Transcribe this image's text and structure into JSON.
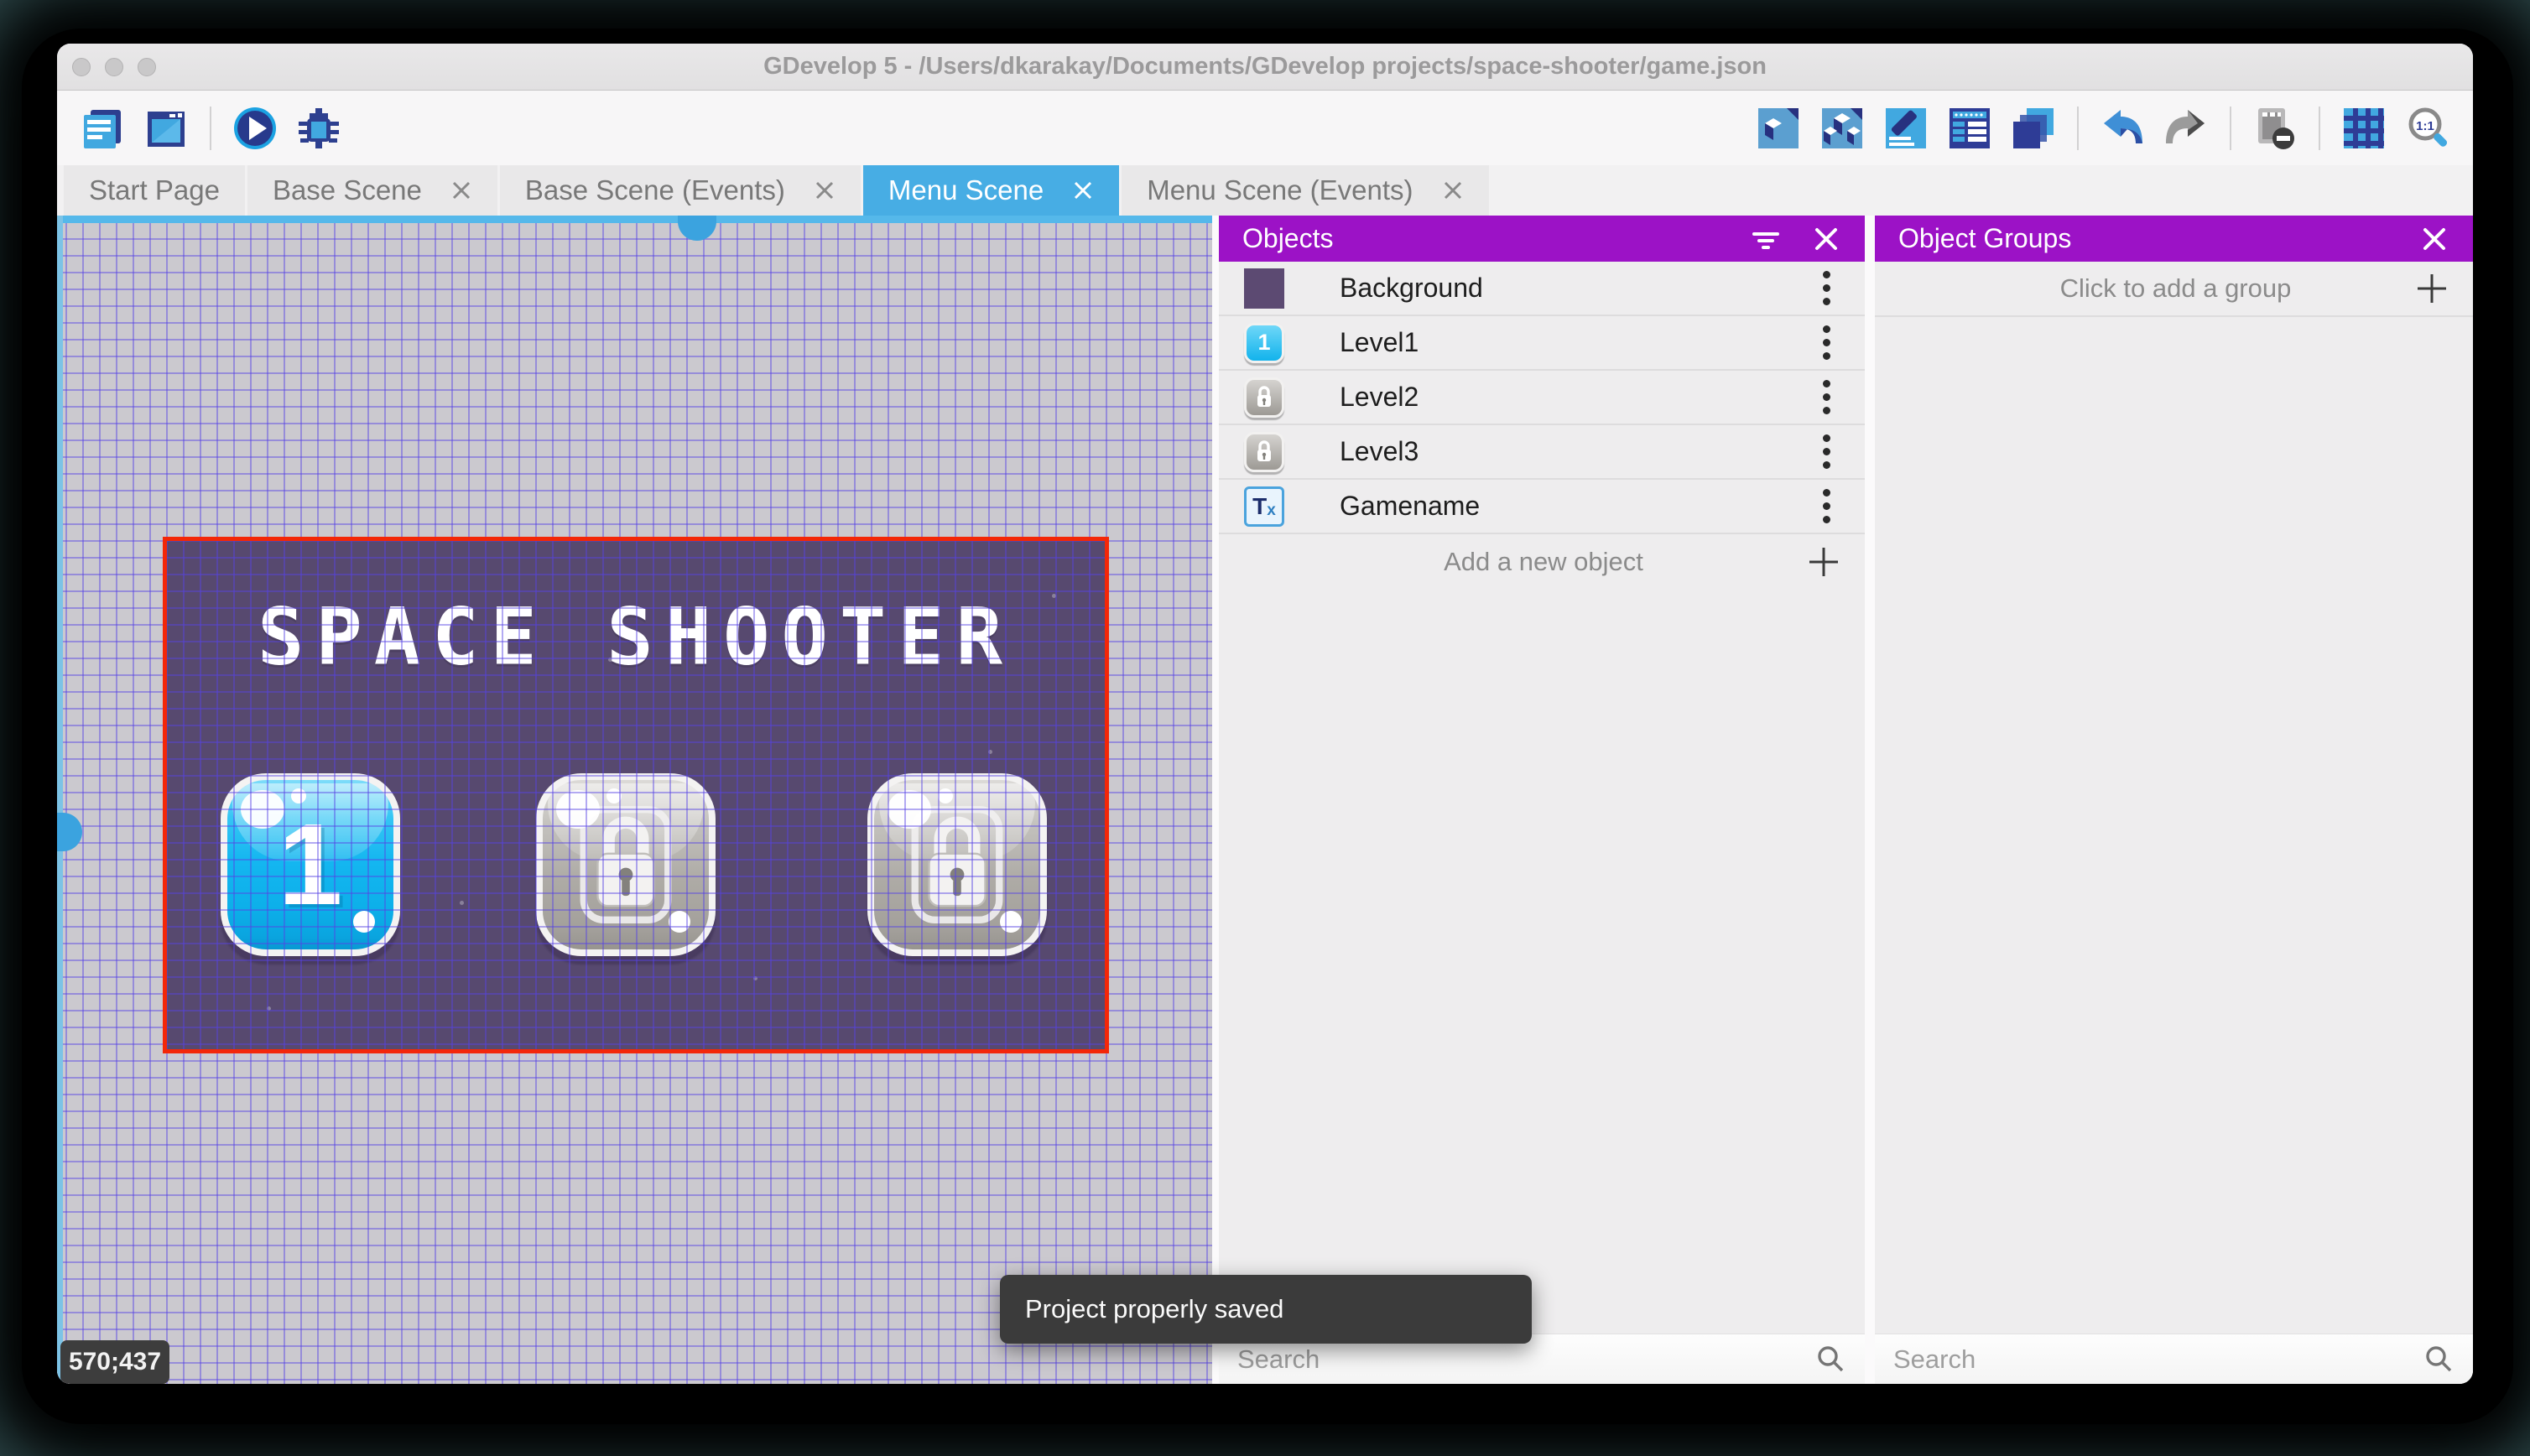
{
  "window": {
    "title": "GDevelop 5 - /Users/dkarakay/Documents/GDevelop projects/space-shooter/game.json"
  },
  "tabs": [
    {
      "label": "Start Page",
      "closable": false,
      "active": false
    },
    {
      "label": "Base Scene",
      "closable": true,
      "active": false
    },
    {
      "label": "Base Scene (Events)",
      "closable": true,
      "active": false
    },
    {
      "label": "Menu Scene",
      "closable": true,
      "active": true
    },
    {
      "label": "Menu Scene (Events)",
      "closable": true,
      "active": false
    }
  ],
  "canvas": {
    "coordinates": "570;437",
    "scene": {
      "title": "SPACE SHOOTER",
      "buttons": [
        {
          "name": "Level1",
          "label": "1",
          "locked": false
        },
        {
          "name": "Level2",
          "locked": true
        },
        {
          "name": "Level3",
          "locked": true
        }
      ]
    }
  },
  "objects_panel": {
    "title": "Objects",
    "items": [
      {
        "name": "Background"
      },
      {
        "name": "Level1"
      },
      {
        "name": "Level2"
      },
      {
        "name": "Level3"
      },
      {
        "name": "Gamename"
      }
    ],
    "gamename_icon_text": "T",
    "gamename_icon_sub": "x",
    "add_label": "Add a new object",
    "search_placeholder": "Search"
  },
  "groups_panel": {
    "title": "Object Groups",
    "add_label": "Click to add a group",
    "search_placeholder": "Search"
  },
  "toast": {
    "message": "Project properly saved"
  },
  "colors": {
    "panel_header": "#9c12c6",
    "active_tab": "#47ade4",
    "scene_background": "#57496f",
    "scene_selection_border": "#f32708",
    "canvas_background": "#cbc9cf",
    "toast_background": "#3b3b3b",
    "level_button_blue": "#14b6f0",
    "level_button_gray": "#aeaba6"
  }
}
